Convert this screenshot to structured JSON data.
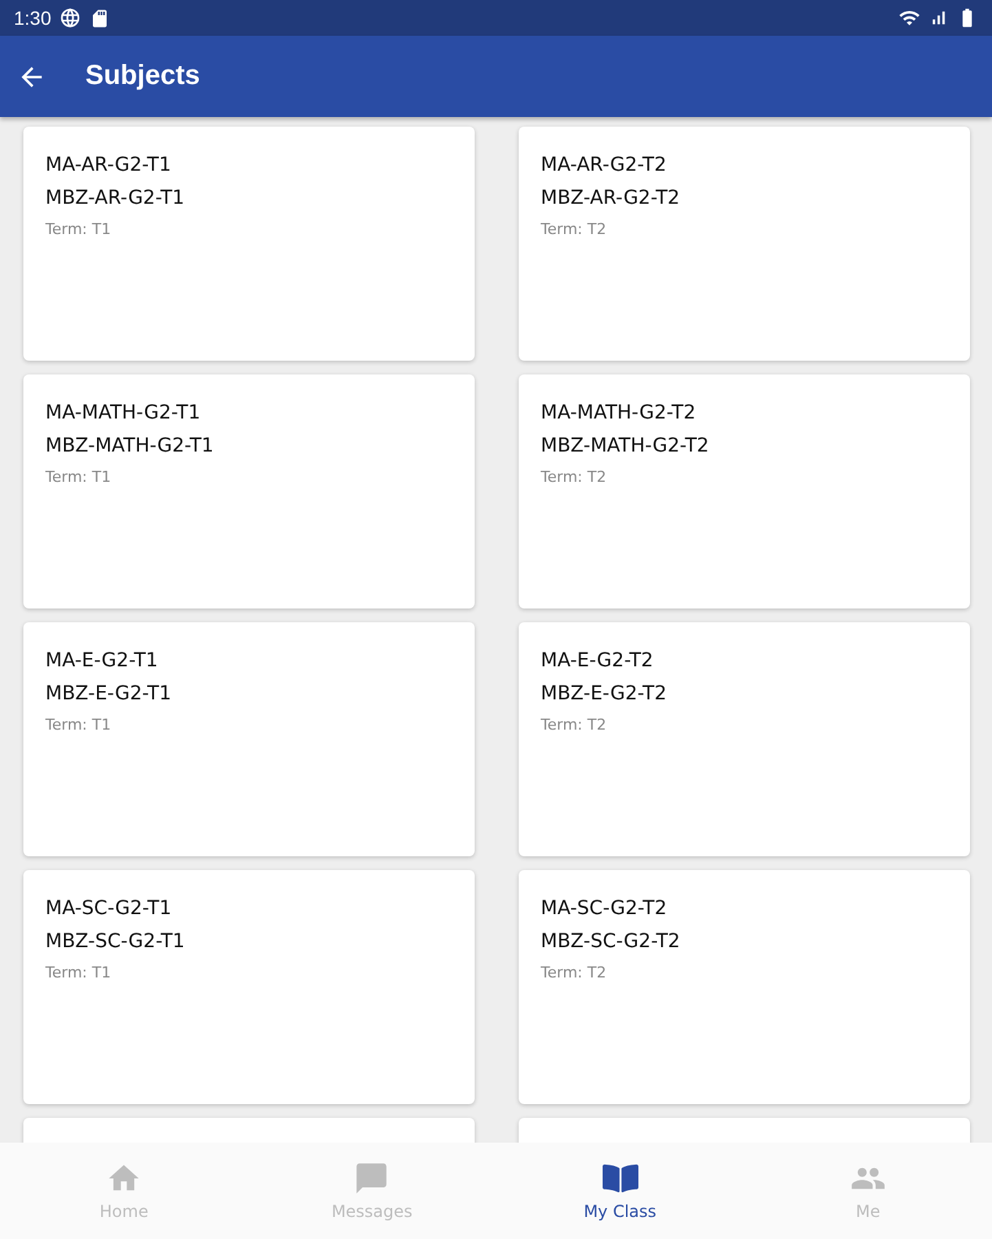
{
  "status_bar": {
    "time": "1:30"
  },
  "app_bar": {
    "title": "Subjects"
  },
  "subjects": [
    {
      "code": "MA-AR-G2-T1",
      "name": "MBZ-AR-G2-T1",
      "term": "Term: T1"
    },
    {
      "code": "MA-AR-G2-T2",
      "name": "MBZ-AR-G2-T2",
      "term": "Term: T2"
    },
    {
      "code": "MA-MATH-G2-T1",
      "name": "MBZ-MATH-G2-T1",
      "term": "Term: T1"
    },
    {
      "code": "MA-MATH-G2-T2",
      "name": "MBZ-MATH-G2-T2",
      "term": "Term: T2"
    },
    {
      "code": "MA-E-G2-T1",
      "name": "MBZ-E-G2-T1",
      "term": "Term: T1"
    },
    {
      "code": "MA-E-G2-T2",
      "name": "MBZ-E-G2-T2",
      "term": "Term: T2"
    },
    {
      "code": "MA-SC-G2-T1",
      "name": "MBZ-SC-G2-T1",
      "term": "Term: T1"
    },
    {
      "code": "MA-SC-G2-T2",
      "name": "MBZ-SC-G2-T2",
      "term": "Term: T2"
    }
  ],
  "bottom_nav": [
    {
      "kind": "home",
      "label": "Home",
      "selected": false
    },
    {
      "kind": "messages",
      "label": "Messages",
      "selected": false
    },
    {
      "kind": "class",
      "label": "My Class",
      "selected": true
    },
    {
      "kind": "people",
      "label": "Me",
      "selected": false
    }
  ]
}
